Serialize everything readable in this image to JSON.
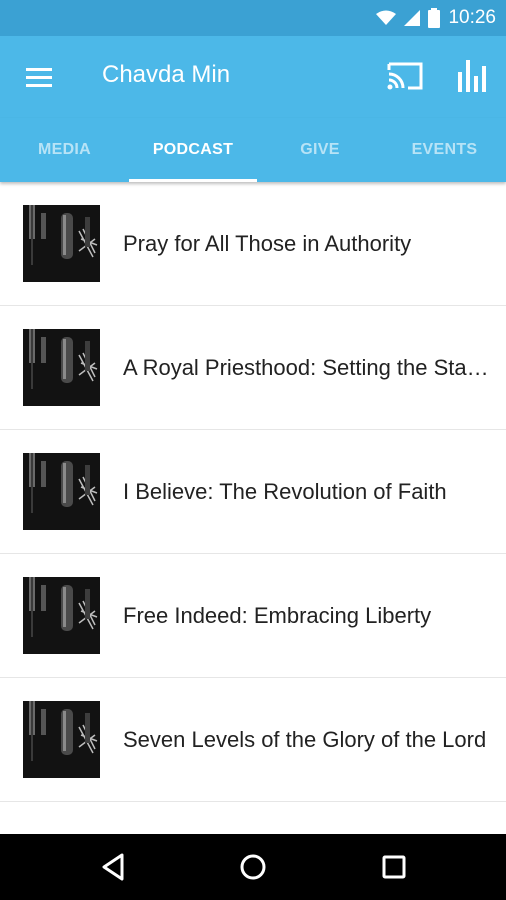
{
  "status_bar": {
    "time": "10:26",
    "icons": [
      "wifi-icon",
      "signal-icon",
      "battery-icon"
    ]
  },
  "app_bar": {
    "title": "Chavda Min",
    "icons": [
      "menu-icon",
      "cast-icon",
      "bar-chart-icon"
    ],
    "color": "#4cb8e8"
  },
  "tabs": [
    {
      "label": "MEDIA",
      "active": false
    },
    {
      "label": "PODCAST",
      "active": true
    },
    {
      "label": "GIVE",
      "active": false
    },
    {
      "label": "EVENTS",
      "active": false
    }
  ],
  "podcasts": [
    {
      "title": "Pray for All Those in Authority"
    },
    {
      "title": "A Royal Priesthood: Setting the Stage for Glory"
    },
    {
      "title": "I Believe: The Revolution of Faith"
    },
    {
      "title": "Free Indeed: Embracing Liberty"
    },
    {
      "title": "Seven Levels of the Glory of the Lord"
    }
  ],
  "nav_bar": {
    "icons": [
      "back-icon",
      "home-icon",
      "recents-icon"
    ]
  }
}
